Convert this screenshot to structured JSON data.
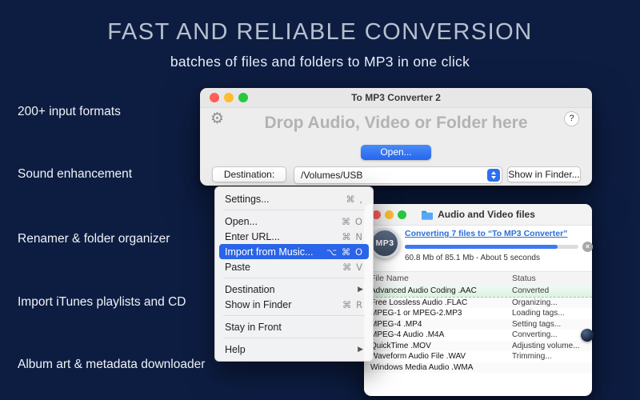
{
  "hero": {
    "title": "FAST AND RELIABLE CONVERSION",
    "subtitle": "batches of files and folders to MP3 in one click"
  },
  "features": [
    {
      "label": "200+ input formats"
    },
    {
      "label": "Sound enhancement"
    },
    {
      "label": "Renamer & folder organizer"
    },
    {
      "label": "Import iTunes playlists and CD"
    },
    {
      "label": "Album art & metadata downloader"
    }
  ],
  "icons": {
    "gear": "⚙",
    "help": "?",
    "cancel": "×",
    "submenu_arrow": "▶"
  },
  "converter_window": {
    "title": "To MP3 Converter 2",
    "drop_zone_text": "Drop Audio, Video or Folder here",
    "open_button": "Open...",
    "destination_button": "Destination:",
    "destination_path": "/Volumes/USB",
    "show_in_finder_button": "Show in Finder..."
  },
  "context_menu": {
    "items": [
      {
        "type": "item",
        "label": "Settings...",
        "shortcut": "⌘ ,"
      },
      {
        "type": "separator"
      },
      {
        "type": "item",
        "label": "Open...",
        "shortcut": "⌘ O"
      },
      {
        "type": "item",
        "label": "Enter URL...",
        "shortcut": "⌘ N"
      },
      {
        "type": "item",
        "label": "Import from Music...",
        "shortcut": "⌥ ⌘ O",
        "highlighted": true
      },
      {
        "type": "item",
        "label": "Paste",
        "shortcut": "⌘ V"
      },
      {
        "type": "separator"
      },
      {
        "type": "item",
        "label": "Destination",
        "submenu": true
      },
      {
        "type": "item",
        "label": "Show in Finder",
        "shortcut": "⌘ R"
      },
      {
        "type": "separator"
      },
      {
        "type": "item",
        "label": "Stay in Front"
      },
      {
        "type": "separator"
      },
      {
        "type": "item",
        "label": "Help",
        "submenu": true
      }
    ]
  },
  "files_window": {
    "title": "Audio and Video files",
    "badge": "MP3",
    "status_link": "Converting 7 files to “To MP3 Converter”",
    "progress_percent": 88,
    "progress_detail": "60.8 Mb of 85.1 Mb - About 5 seconds",
    "columns": [
      "File Name",
      "Status"
    ],
    "rows": [
      {
        "name": "Advanced Audio Coding .AAC",
        "status": "Converted",
        "highlighted": true
      },
      {
        "name": "Free Lossless Audio .FLAC",
        "status": "Organizing..."
      },
      {
        "name": "MPEG-1 or MPEG-2.MP3",
        "status": "Loading tags..."
      },
      {
        "name": "MPEG-4 .MP4",
        "status": "Setting tags..."
      },
      {
        "name": "MPEG-4 Audio .M4A",
        "status": "Converting..."
      },
      {
        "name": "QuickTime .MOV",
        "status": "Adjusting volume..."
      },
      {
        "name": "Waveform Audio File .WAV",
        "status": "Trimming..."
      },
      {
        "name": "Windows Media Audio .WMA",
        "status": ""
      }
    ]
  },
  "colors": {
    "background": "#0d1d42",
    "accent_blue": "#2e6ff2",
    "menu_highlight": "#2a64e8",
    "traffic_red": "#ff5f57",
    "traffic_yellow": "#febc2e",
    "traffic_green": "#28c840"
  }
}
